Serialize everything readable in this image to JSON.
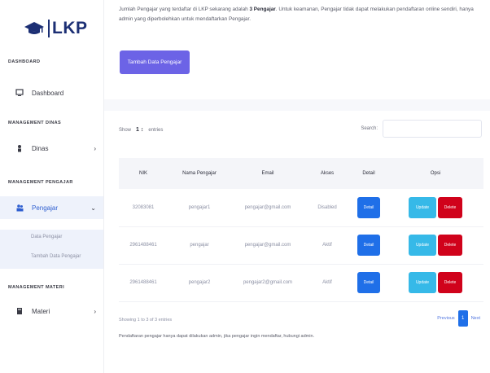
{
  "brand": {
    "name": "LKP"
  },
  "sidebar": {
    "sections": [
      {
        "heading": "DASHBOARD"
      },
      {
        "heading": "MANAGEMENT DINAS"
      },
      {
        "heading": "MANAGEMENT PENGAJAR"
      },
      {
        "heading": "MANAGEMENT MATERI"
      }
    ],
    "items": [
      {
        "label": "Dashboard",
        "icon": "monitor-icon"
      },
      {
        "label": "Dinas",
        "icon": "user-icon"
      },
      {
        "label": "Pengajar",
        "icon": "users-icon"
      },
      {
        "label": "Materi",
        "icon": "book-icon"
      }
    ],
    "sub_items": [
      "Data Pengajar",
      "Tambah Data Pengajar"
    ]
  },
  "main": {
    "intro_text_1": "Jumlah Pengajar yang terdaftar di LKP sekarang adalah ",
    "intro_count": "3 Pengajar",
    "intro_text_2": ". Untuk keamanan, Pengajar tidak dapat melakukan pendaftaran online sendiri, hanya admin yang diperbolehkan untuk mendaftarkan Pengajar.",
    "add_button": "Tambah Data Pengajar",
    "show_label": "Show",
    "show_value": "1 ↕",
    "entries_label": "entries",
    "search_label": "Search:",
    "search_placeholder": "",
    "table": {
      "headers": [
        "NIK",
        "Nama Pengajar",
        "Email",
        "Akses",
        "Detail",
        "Opsi"
      ],
      "rows": [
        {
          "nik": "32083081",
          "nama": "pengajar1",
          "email": "pengajar@gmail.com",
          "akses": "Disabled"
        },
        {
          "nik": "2961488461",
          "nama": "pengajar",
          "email": "pengajar@gmail.com",
          "akses": "Aktif"
        },
        {
          "nik": "2961488461",
          "nama": "pengajar2",
          "email": "pengajar2@gmail.com",
          "akses": "Aktif"
        }
      ],
      "detail_label": "Detail",
      "update_label": "Update",
      "delete_label": "Delete"
    },
    "footer_info": "Showing 1 to 3 of 3 entries",
    "footer_note": "Pendaftaran pengajar hanya dapat dilakukan admin, jika pengajar ingin mendaftar, hubungi admin.",
    "pager": {
      "previous": "Previous",
      "current": "1",
      "next": "Next"
    }
  },
  "colors": {
    "brand": "#1c2f74",
    "primary": "#6c63e6",
    "detail": "#1f6fe8",
    "update": "#36b9e8",
    "delete": "#d0021b"
  }
}
